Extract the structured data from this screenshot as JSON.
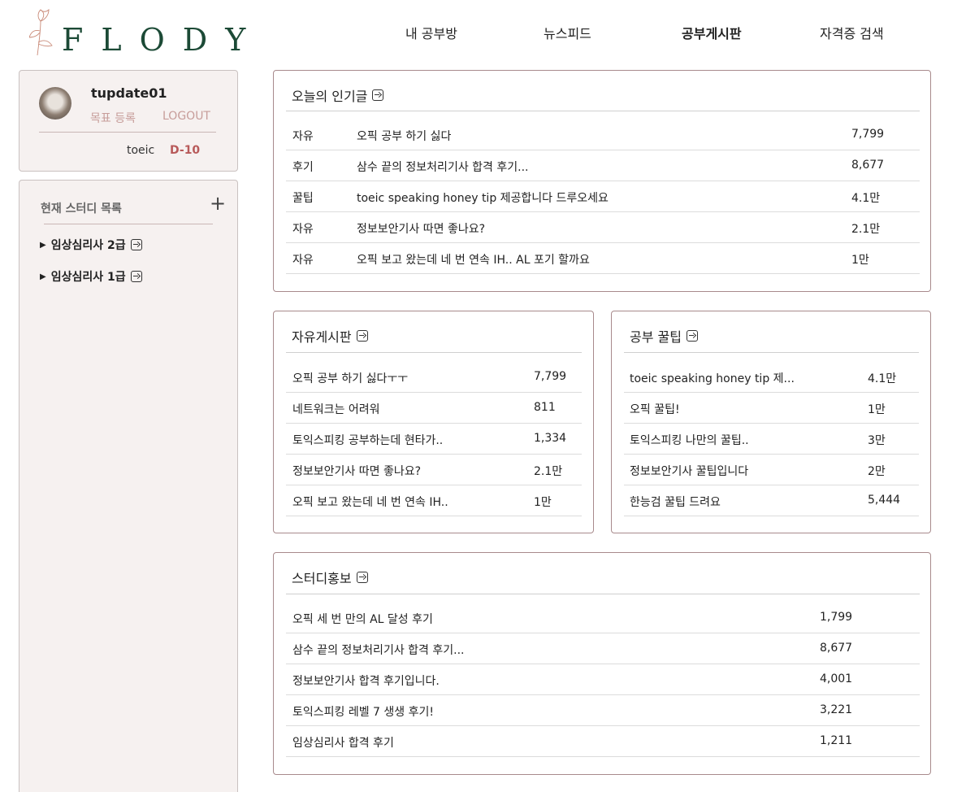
{
  "brand": {
    "name": "FLODY"
  },
  "nav": [
    {
      "label": "내 공부방",
      "active": false
    },
    {
      "label": "뉴스피드",
      "active": false
    },
    {
      "label": "공부게시판",
      "active": true
    },
    {
      "label": "자격증 검색",
      "active": false
    }
  ],
  "profile": {
    "username": "tupdate01",
    "goal_register": "목표 등록",
    "logout": "LOGOUT",
    "goal_name": "toeic",
    "goal_dday": "D-10"
  },
  "study": {
    "title": "현재 스터디 목록",
    "items": [
      {
        "label": "임상심리사 2급"
      },
      {
        "label": "임상심리사 1급"
      }
    ]
  },
  "popular": {
    "title": "오늘의 인기글",
    "rows": [
      {
        "category": "자유",
        "title": "오픽 공부 하기 싫다",
        "views": "7,799"
      },
      {
        "category": "후기",
        "title": "삼수 끝의 정보처리기사 합격 후기...",
        "views": "8,677"
      },
      {
        "category": "꿀팁",
        "title": "toeic speaking honey tip 제공합니다 드루오세요",
        "views": "4.1만"
      },
      {
        "category": "자유",
        "title": "정보보안기사 따면 좋나요?",
        "views": "2.1만"
      },
      {
        "category": "자유",
        "title": "오픽 보고 왔는데 네 번 연속 IH.. AL 포기 할까요",
        "views": "1만"
      }
    ]
  },
  "free_board": {
    "title": "자유게시판",
    "rows": [
      {
        "title": "오픽 공부 하기 싫다ㅜㅜ",
        "views": "7,799"
      },
      {
        "title": "네트워크는 어려워",
        "views": "811"
      },
      {
        "title": "토익스피킹 공부하는데 현타가..",
        "views": "1,334"
      },
      {
        "title": "정보보안기사 따면 좋나요?",
        "views": "2.1만"
      },
      {
        "title": "오픽 보고 왔는데 네 번 연속 IH..",
        "views": "1만"
      }
    ]
  },
  "tips_board": {
    "title": "공부 꿀팁",
    "rows": [
      {
        "title": "toeic speaking honey tip 제...",
        "views": "4.1만"
      },
      {
        "title": "오픽 꿀팁!",
        "views": "1만"
      },
      {
        "title": "토익스피킹 나만의 꿀팁..",
        "views": "3만"
      },
      {
        "title": "정보보안기사 꿀팁입니다",
        "views": "2만"
      },
      {
        "title": "한능검 꿀팁 드려요",
        "views": "5,444"
      }
    ]
  },
  "promo_board": {
    "title": "스터디홍보",
    "rows": [
      {
        "title": "오픽 세 번 만의 AL 달성 후기",
        "views": "1,799"
      },
      {
        "title": "삼수 끝의 정보처리기사 합격 후기...",
        "views": "8,677"
      },
      {
        "title": "정보보안기사 합격 후기입니다.",
        "views": "4,001"
      },
      {
        "title": "토익스피킹 레벨 7 생생 후기!",
        "views": "3,221"
      },
      {
        "title": "임상심리사 합격 후기",
        "views": "1,211"
      }
    ]
  },
  "colors": {
    "brand_green": "#1c4a36",
    "accent_rose": "#b85a5a",
    "panel_bg": "#f6f1f0",
    "board_border": "#a88a8c"
  }
}
